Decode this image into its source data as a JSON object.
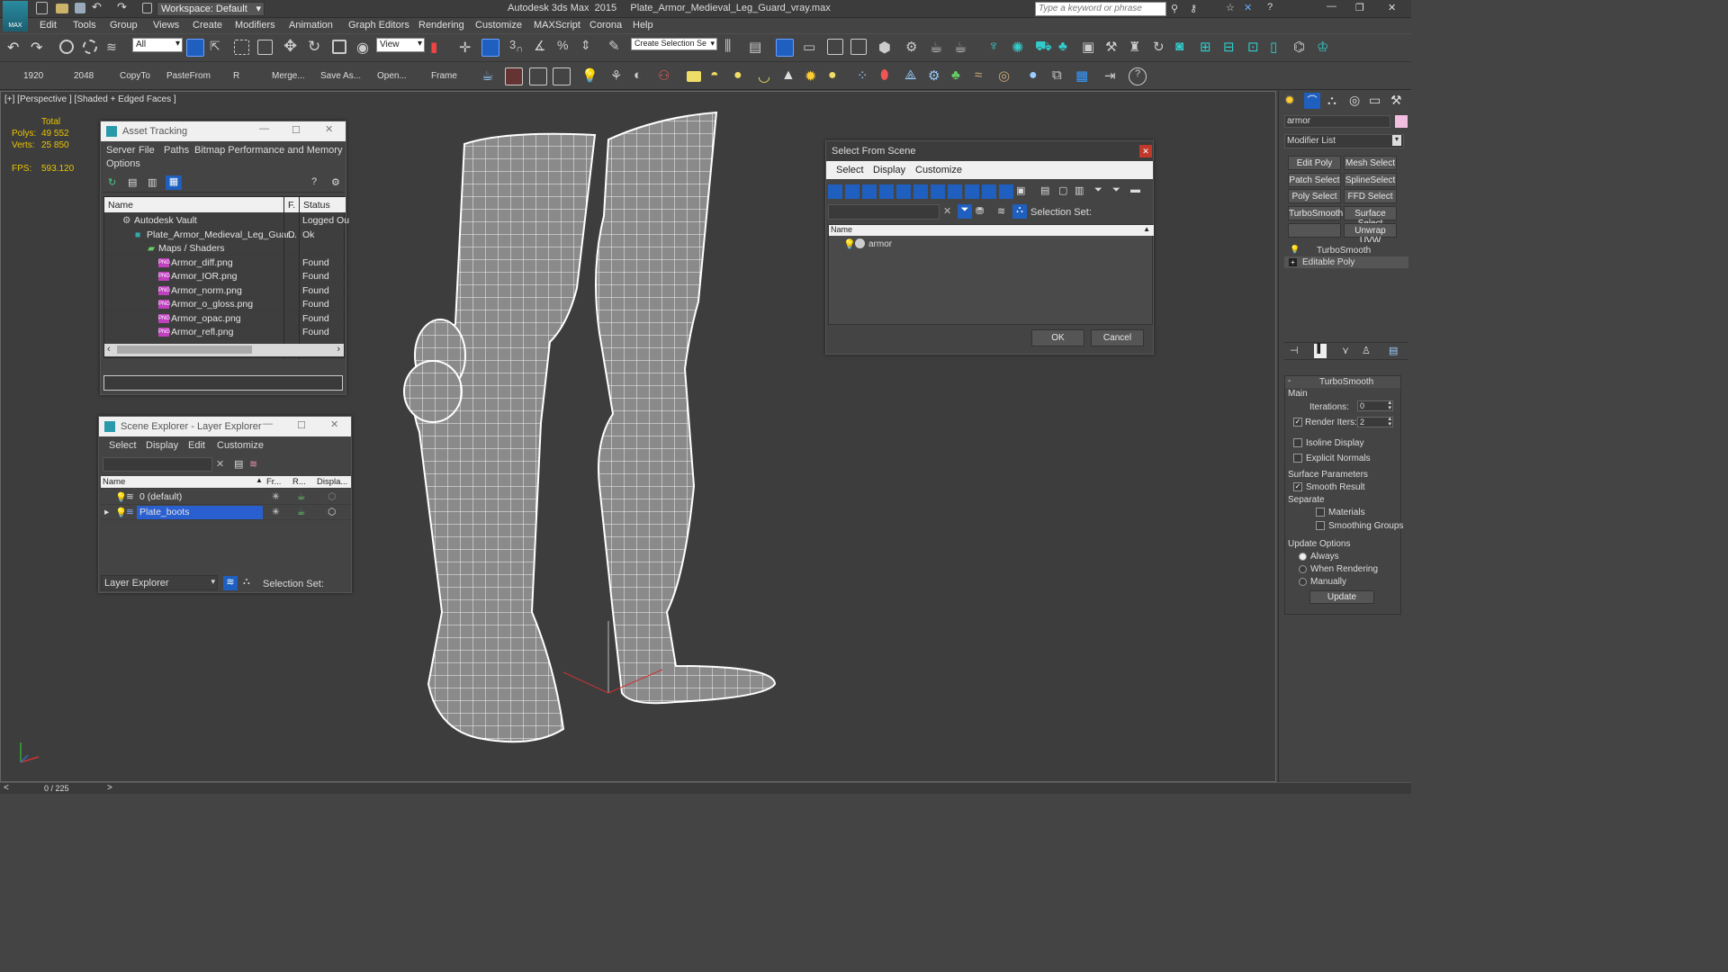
{
  "titlebar": {
    "workspace": "Workspace: Default",
    "title": "Autodesk 3ds Max  2015     Plate_Armor_Medieval_Leg_Guard_vray.max",
    "search_placeholder": "Type a keyword or phrase"
  },
  "menubar": [
    "Edit",
    "Tools",
    "Group",
    "Views",
    "Create",
    "Modifiers",
    "Animation",
    "Graph Editors",
    "Rendering",
    "Customize",
    "MAXScript",
    "Corona",
    "Help"
  ],
  "toolbar1": {
    "filter_value": "All",
    "refcoord_value": "View",
    "selection_set_value": "Create Selection Se"
  },
  "toolbar2": {
    "items": [
      "1920",
      "2048",
      "CopyTo",
      "PasteFrom",
      "R",
      "Merge...",
      "Save As...",
      "Open...",
      "Frame"
    ]
  },
  "viewport": {
    "label": "[+] [Perspective ] [Shaded + Edged Faces ]",
    "stats": {
      "total_label": "Total",
      "polys_label": "Polys:",
      "polys_value": "49 552",
      "verts_label": "Verts:",
      "verts_value": "25 850",
      "fps_label": "FPS:",
      "fps_value": "593.120"
    }
  },
  "asset_tracking": {
    "title": "Asset Tracking",
    "menu": [
      "Server",
      "File",
      "Paths",
      "Bitmap Performance and Memory",
      "Options"
    ],
    "columns": [
      "Name",
      "F.",
      "Status"
    ],
    "rows": [
      {
        "name": "Autodesk Vault",
        "f": "",
        "status": "Logged Ou"
      },
      {
        "name": "Plate_Armor_Medieval_Leg_Guar...",
        "f": "D",
        "status": "Ok"
      },
      {
        "name": "Maps / Shaders",
        "f": "",
        "status": ""
      },
      {
        "name": "Armor_diff.png",
        "f": "",
        "status": "Found"
      },
      {
        "name": "Armor_IOR.png",
        "f": "",
        "status": "Found"
      },
      {
        "name": "Armor_norm.png",
        "f": "",
        "status": "Found"
      },
      {
        "name": "Armor_o_gloss.png",
        "f": "",
        "status": "Found"
      },
      {
        "name": "Armor_opac.png",
        "f": "",
        "status": "Found"
      },
      {
        "name": "Armor_refl.png",
        "f": "",
        "status": "Found"
      }
    ]
  },
  "scene_explorer": {
    "title": "Scene Explorer - Layer Explorer",
    "menu": [
      "Select",
      "Display",
      "Edit",
      "Customize"
    ],
    "columns": [
      "Name",
      "Fr...",
      "R...",
      "Displa..."
    ],
    "rows": [
      {
        "name": "0 (default)"
      },
      {
        "name": "Plate_boots"
      }
    ],
    "footer_dropdown": "Layer Explorer",
    "selection_set_label": "Selection Set:"
  },
  "select_from_scene": {
    "title": "Select From Scene",
    "menu": [
      "Select",
      "Display",
      "Customize"
    ],
    "selection_set_label": "Selection Set:",
    "column": "Name",
    "items": [
      "armor"
    ],
    "ok": "OK",
    "cancel": "Cancel"
  },
  "command_panel": {
    "object_name": "armor",
    "modifier_list": "Modifier List",
    "buttons": [
      "Edit Poly",
      "Mesh Select",
      "Patch Select",
      "SplineSelect",
      "Poly Select",
      "FFD Select",
      "TurboSmooth",
      "Surface Select",
      "",
      "Unwrap UVW"
    ],
    "stack": [
      "TurboSmooth",
      "Editable Poly"
    ],
    "rollout_title": "TurboSmooth",
    "main_label": "Main",
    "iterations_label": "Iterations:",
    "iterations_value": "0",
    "render_iters_label": "Render Iters:",
    "render_iters_value": "2",
    "isoline": "Isoline Display",
    "explicit": "Explicit Normals",
    "surface_params": "Surface Parameters",
    "smooth_result": "Smooth Result",
    "separate": "Separate",
    "materials": "Materials",
    "smoothing_groups": "Smoothing Groups",
    "update_options": "Update Options",
    "always": "Always",
    "when_rendering": "When Rendering",
    "manually": "Manually",
    "update_btn": "Update"
  },
  "statusbar": {
    "frame": "0 / 225"
  },
  "colors": {
    "accent": "#1e5fbf",
    "viewport_bg": "#3d3d3d",
    "stats_yellow": "#e8c400",
    "selected_row": "#2a5fd0"
  }
}
